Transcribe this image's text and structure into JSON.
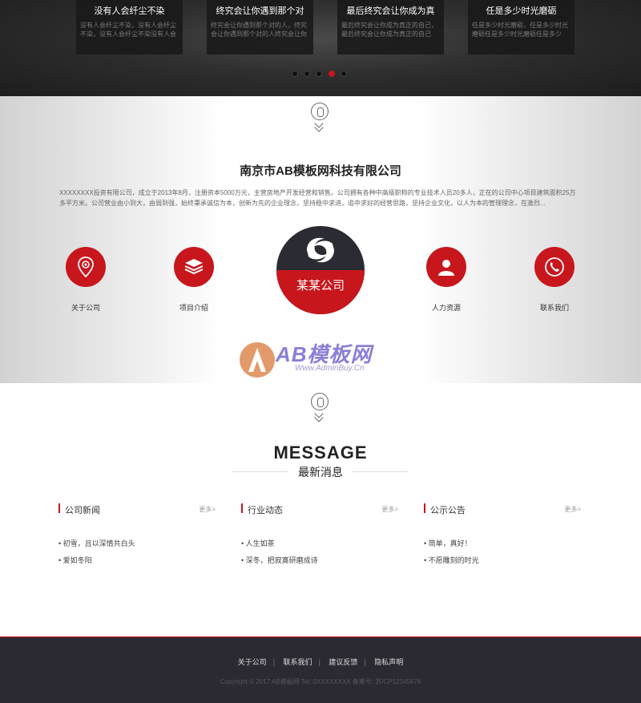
{
  "banner": {
    "cards": [
      {
        "title": "没有人会纤尘不染",
        "desc": "没有人会纤尘不染，没有人会纤尘不染，没有人会纤尘不染没有人会"
      },
      {
        "title": "终究会让你遇到那个对",
        "desc": "终究会让你遇到那个对的人，终究会让你遇到那个对的人终究会让你"
      },
      {
        "title": "最后终究会让你成为真",
        "desc": "最后终究会让你成为真正的自己，最后终究会让你成为真正的自己"
      },
      {
        "title": "任是多少时光磨砺",
        "desc": "任是多少时光磨砺，任是多少时光磨砺任是多少时光磨砺任是多少"
      }
    ],
    "active_dot": 3,
    "dot_count": 5
  },
  "about": {
    "title": "南京市AB模板网科技有限公司",
    "description": "XXXXXXXX投资有限公司，成立于2013年8月，注册资本5000万元，主营房地产开发经营和销售。公司拥有各种中高级职称的专业技术人员20多人，正在的公司中心项目建筑面积25万多平方米。公司营业由小到大，由弱到强，始终秉承诚信为本，创新为先的企业理念，坚持稳中求进，追中求好的经营思路，坚持企业文化，以人为本的管理理念，在激烈...",
    "features": [
      {
        "label": "关于公司",
        "icon": "location-pin-icon"
      },
      {
        "label": "项目介绍",
        "icon": "layers-icon"
      },
      {
        "label": "人力资源",
        "icon": "user-icon"
      },
      {
        "label": "联系我们",
        "icon": "phone-icon"
      }
    ],
    "logo_text": "某某公司",
    "watermark": {
      "brand": "AB模板网",
      "url": "Www.AdminBuy.Cn"
    }
  },
  "message": {
    "title": "MESSAGE",
    "subtitle": "最新消息",
    "more_label": "更多>",
    "columns": [
      {
        "title": "公司新闻",
        "items": [
          "初雪，且以深情共白头",
          "爱如冬阳"
        ]
      },
      {
        "title": "行业动态",
        "items": [
          "人生如茶",
          "深冬，把寂寞研磨成诗"
        ]
      },
      {
        "title": "公示公告",
        "items": [
          "简单，真好！",
          "不愿雕刻的时光"
        ]
      }
    ]
  },
  "footer": {
    "links": [
      "关于公司",
      "联系我们",
      "建议反馈",
      "隐私声明"
    ],
    "copyright": "Copyright © 2017 AB模板网 Tel: 0XXXXXXXX 备案号: 苏ICP12345678"
  },
  "colors": {
    "accent": "#c8161d",
    "dark": "#2b2a33"
  }
}
